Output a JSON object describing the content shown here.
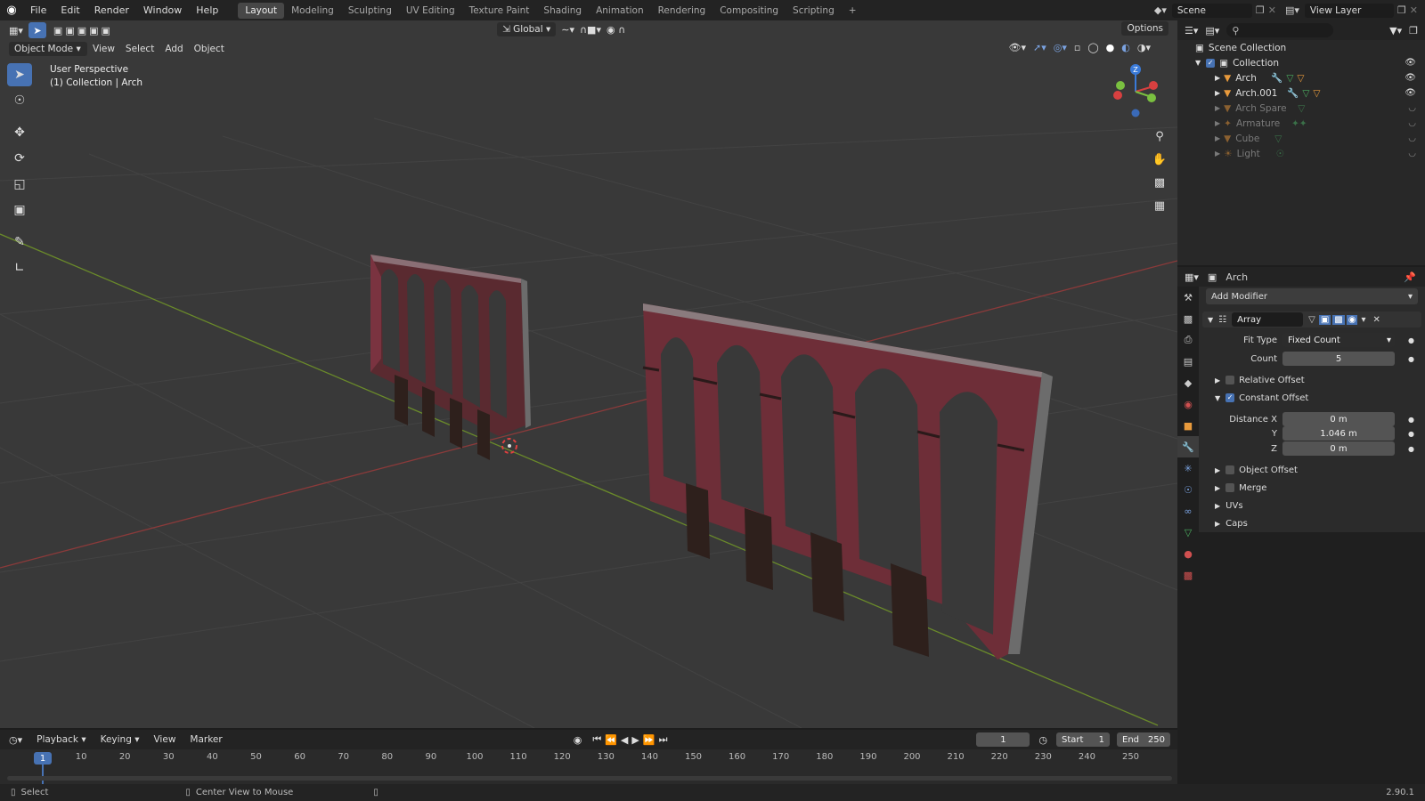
{
  "topbar": {
    "menus": [
      "File",
      "Edit",
      "Render",
      "Window",
      "Help"
    ],
    "workspaces": [
      "Layout",
      "Modeling",
      "Sculpting",
      "UV Editing",
      "Texture Paint",
      "Shading",
      "Animation",
      "Rendering",
      "Compositing",
      "Scripting"
    ],
    "active_workspace": "Layout",
    "add_workspace": "+",
    "scene": "Scene",
    "view_layer": "View Layer"
  },
  "viewport": {
    "mode": "Object Mode",
    "menus": [
      "View",
      "Select",
      "Add",
      "Object"
    ],
    "orientation": "Global",
    "options": "Options",
    "overlay_title": "User Perspective",
    "overlay_sub": "(1) Collection | Arch",
    "gizmo_z": "Z"
  },
  "outliner": {
    "root": "Scene Collection",
    "collection": "Collection",
    "items": [
      {
        "name": "Arch",
        "dim": false
      },
      {
        "name": "Arch.001",
        "dim": false
      },
      {
        "name": "Arch Spare",
        "dim": true
      },
      {
        "name": "Armature",
        "dim": true
      },
      {
        "name": "Cube",
        "dim": true
      },
      {
        "name": "Light",
        "dim": true
      }
    ]
  },
  "properties": {
    "object": "Arch",
    "add_modifier": "Add Modifier",
    "modifier_name": "Array",
    "fit_type_label": "Fit Type",
    "fit_type": "Fixed Count",
    "count_label": "Count",
    "count": "5",
    "relative_offset": "Relative Offset",
    "constant_offset": "Constant Offset",
    "distance_x_label": "Distance X",
    "distance_x": "0 m",
    "y_label": "Y",
    "y": "1.046 m",
    "z_label": "Z",
    "z": "0 m",
    "object_offset": "Object Offset",
    "merge": "Merge",
    "uvs": "UVs",
    "caps": "Caps"
  },
  "timeline": {
    "menus": [
      "Playback",
      "Keying",
      "View",
      "Marker"
    ],
    "current_frame": "1",
    "start_label": "Start",
    "start": "1",
    "end_label": "End",
    "end": "250",
    "ticks": [
      "10",
      "20",
      "30",
      "40",
      "50",
      "60",
      "70",
      "80",
      "90",
      "100",
      "110",
      "120",
      "130",
      "140",
      "150",
      "160",
      "170",
      "180",
      "190",
      "200",
      "210",
      "220",
      "230",
      "240",
      "250"
    ]
  },
  "status": {
    "select": "Select",
    "center_view": "Center View to Mouse",
    "version": "2.90.1"
  }
}
